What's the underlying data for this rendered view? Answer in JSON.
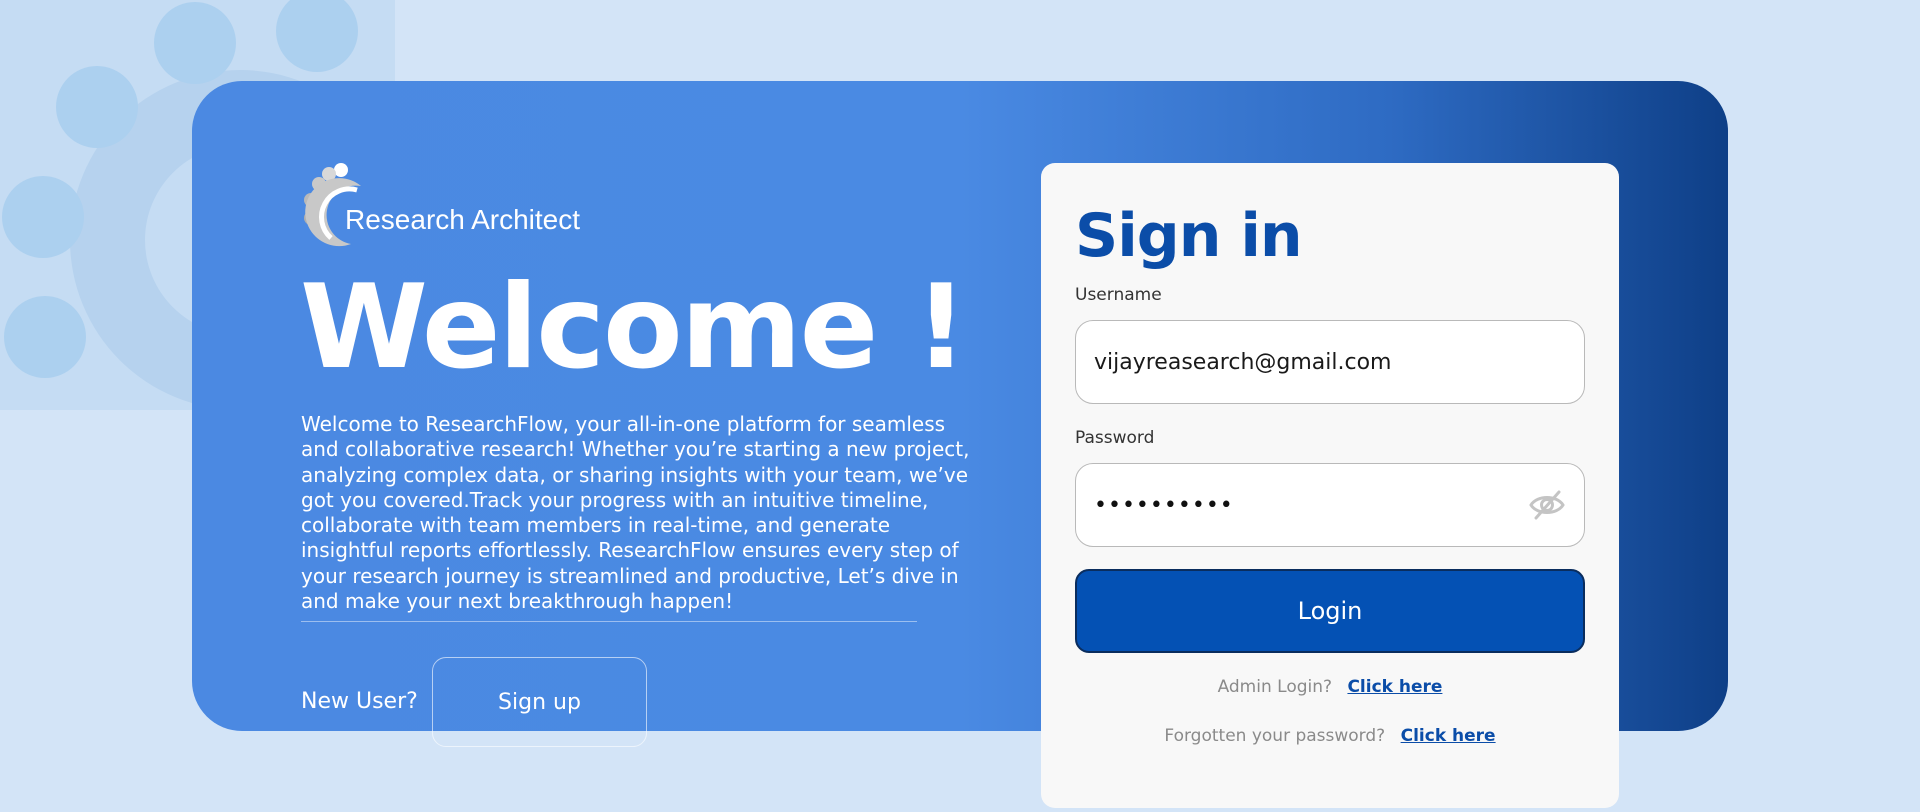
{
  "brand": {
    "name": "Research Architect"
  },
  "hero": {
    "title": "Welcome !",
    "description": "Welcome to ResearchFlow, your all-in-one platform for seamless and collaborative research! Whether you’re starting a new project, analyzing complex data, or sharing insights with your team, we’ve got you covered.Track your progress with an intuitive timeline, collaborate with team members in real-time, and generate insightful reports effortlessly. ResearchFlow ensures every step of your research journey is streamlined and productive, Let’s dive in and make your next breakthrough happen!",
    "new_user_label": "New User?",
    "signup_label": "Sign up"
  },
  "signin": {
    "title": "Sign in",
    "username_label": "Username",
    "username_value": "vijayreasearch@gmail.com",
    "password_label": "Password",
    "password_masked": "••••••••••",
    "password_toggle_icon": "eye-slash-icon",
    "login_label": "Login",
    "admin_prompt": "Admin Login?",
    "admin_link": "Click here",
    "forgot_prompt": "Forgotten your password?",
    "forgot_link": "Click here"
  },
  "colors": {
    "page_bg": "#d3e4f7",
    "hero_start": "#4b89e2",
    "hero_end": "#0e3f87",
    "accent": "#0451b4",
    "title_blue": "#0b4da8"
  }
}
